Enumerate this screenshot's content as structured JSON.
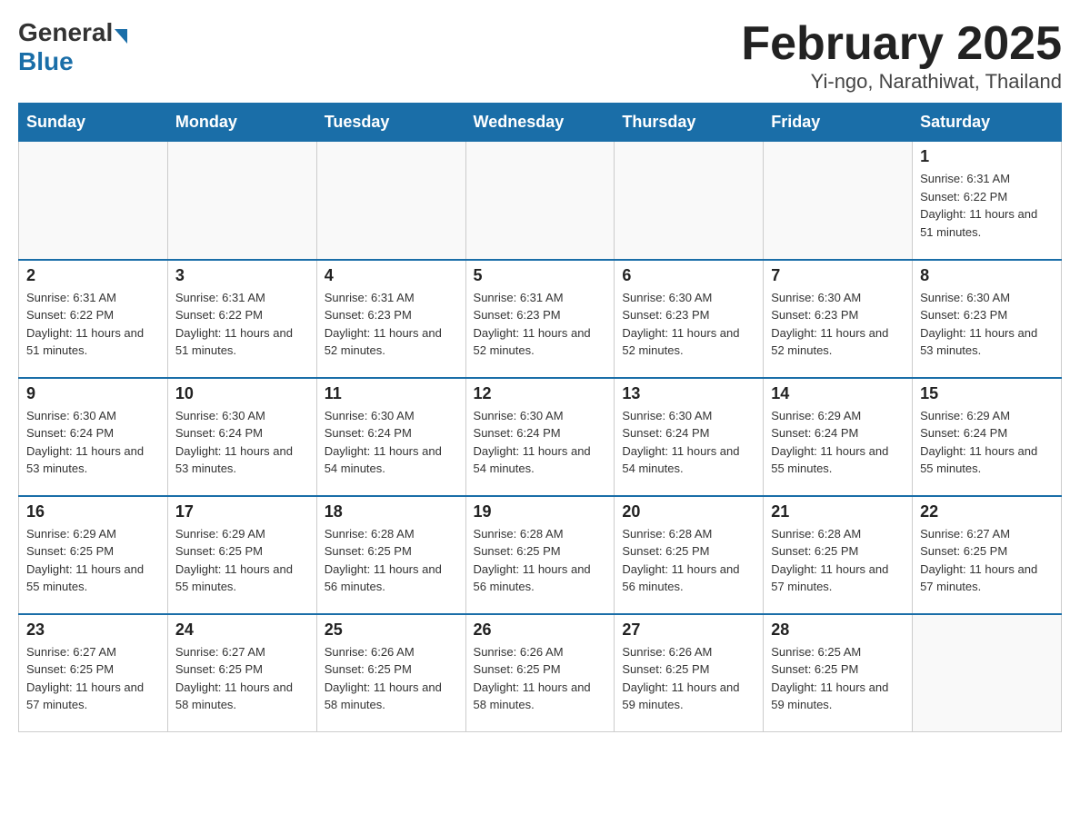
{
  "header": {
    "logo_general": "General",
    "logo_blue": "Blue",
    "month_title": "February 2025",
    "location": "Yi-ngo, Narathiwat, Thailand"
  },
  "days_of_week": [
    "Sunday",
    "Monday",
    "Tuesday",
    "Wednesday",
    "Thursday",
    "Friday",
    "Saturday"
  ],
  "weeks": [
    [
      {
        "day": "",
        "sunrise": "",
        "sunset": "",
        "daylight": ""
      },
      {
        "day": "",
        "sunrise": "",
        "sunset": "",
        "daylight": ""
      },
      {
        "day": "",
        "sunrise": "",
        "sunset": "",
        "daylight": ""
      },
      {
        "day": "",
        "sunrise": "",
        "sunset": "",
        "daylight": ""
      },
      {
        "day": "",
        "sunrise": "",
        "sunset": "",
        "daylight": ""
      },
      {
        "day": "",
        "sunrise": "",
        "sunset": "",
        "daylight": ""
      },
      {
        "day": "1",
        "sunrise": "Sunrise: 6:31 AM",
        "sunset": "Sunset: 6:22 PM",
        "daylight": "Daylight: 11 hours and 51 minutes."
      }
    ],
    [
      {
        "day": "2",
        "sunrise": "Sunrise: 6:31 AM",
        "sunset": "Sunset: 6:22 PM",
        "daylight": "Daylight: 11 hours and 51 minutes."
      },
      {
        "day": "3",
        "sunrise": "Sunrise: 6:31 AM",
        "sunset": "Sunset: 6:22 PM",
        "daylight": "Daylight: 11 hours and 51 minutes."
      },
      {
        "day": "4",
        "sunrise": "Sunrise: 6:31 AM",
        "sunset": "Sunset: 6:23 PM",
        "daylight": "Daylight: 11 hours and 52 minutes."
      },
      {
        "day": "5",
        "sunrise": "Sunrise: 6:31 AM",
        "sunset": "Sunset: 6:23 PM",
        "daylight": "Daylight: 11 hours and 52 minutes."
      },
      {
        "day": "6",
        "sunrise": "Sunrise: 6:30 AM",
        "sunset": "Sunset: 6:23 PM",
        "daylight": "Daylight: 11 hours and 52 minutes."
      },
      {
        "day": "7",
        "sunrise": "Sunrise: 6:30 AM",
        "sunset": "Sunset: 6:23 PM",
        "daylight": "Daylight: 11 hours and 52 minutes."
      },
      {
        "day": "8",
        "sunrise": "Sunrise: 6:30 AM",
        "sunset": "Sunset: 6:23 PM",
        "daylight": "Daylight: 11 hours and 53 minutes."
      }
    ],
    [
      {
        "day": "9",
        "sunrise": "Sunrise: 6:30 AM",
        "sunset": "Sunset: 6:24 PM",
        "daylight": "Daylight: 11 hours and 53 minutes."
      },
      {
        "day": "10",
        "sunrise": "Sunrise: 6:30 AM",
        "sunset": "Sunset: 6:24 PM",
        "daylight": "Daylight: 11 hours and 53 minutes."
      },
      {
        "day": "11",
        "sunrise": "Sunrise: 6:30 AM",
        "sunset": "Sunset: 6:24 PM",
        "daylight": "Daylight: 11 hours and 54 minutes."
      },
      {
        "day": "12",
        "sunrise": "Sunrise: 6:30 AM",
        "sunset": "Sunset: 6:24 PM",
        "daylight": "Daylight: 11 hours and 54 minutes."
      },
      {
        "day": "13",
        "sunrise": "Sunrise: 6:30 AM",
        "sunset": "Sunset: 6:24 PM",
        "daylight": "Daylight: 11 hours and 54 minutes."
      },
      {
        "day": "14",
        "sunrise": "Sunrise: 6:29 AM",
        "sunset": "Sunset: 6:24 PM",
        "daylight": "Daylight: 11 hours and 55 minutes."
      },
      {
        "day": "15",
        "sunrise": "Sunrise: 6:29 AM",
        "sunset": "Sunset: 6:24 PM",
        "daylight": "Daylight: 11 hours and 55 minutes."
      }
    ],
    [
      {
        "day": "16",
        "sunrise": "Sunrise: 6:29 AM",
        "sunset": "Sunset: 6:25 PM",
        "daylight": "Daylight: 11 hours and 55 minutes."
      },
      {
        "day": "17",
        "sunrise": "Sunrise: 6:29 AM",
        "sunset": "Sunset: 6:25 PM",
        "daylight": "Daylight: 11 hours and 55 minutes."
      },
      {
        "day": "18",
        "sunrise": "Sunrise: 6:28 AM",
        "sunset": "Sunset: 6:25 PM",
        "daylight": "Daylight: 11 hours and 56 minutes."
      },
      {
        "day": "19",
        "sunrise": "Sunrise: 6:28 AM",
        "sunset": "Sunset: 6:25 PM",
        "daylight": "Daylight: 11 hours and 56 minutes."
      },
      {
        "day": "20",
        "sunrise": "Sunrise: 6:28 AM",
        "sunset": "Sunset: 6:25 PM",
        "daylight": "Daylight: 11 hours and 56 minutes."
      },
      {
        "day": "21",
        "sunrise": "Sunrise: 6:28 AM",
        "sunset": "Sunset: 6:25 PM",
        "daylight": "Daylight: 11 hours and 57 minutes."
      },
      {
        "day": "22",
        "sunrise": "Sunrise: 6:27 AM",
        "sunset": "Sunset: 6:25 PM",
        "daylight": "Daylight: 11 hours and 57 minutes."
      }
    ],
    [
      {
        "day": "23",
        "sunrise": "Sunrise: 6:27 AM",
        "sunset": "Sunset: 6:25 PM",
        "daylight": "Daylight: 11 hours and 57 minutes."
      },
      {
        "day": "24",
        "sunrise": "Sunrise: 6:27 AM",
        "sunset": "Sunset: 6:25 PM",
        "daylight": "Daylight: 11 hours and 58 minutes."
      },
      {
        "day": "25",
        "sunrise": "Sunrise: 6:26 AM",
        "sunset": "Sunset: 6:25 PM",
        "daylight": "Daylight: 11 hours and 58 minutes."
      },
      {
        "day": "26",
        "sunrise": "Sunrise: 6:26 AM",
        "sunset": "Sunset: 6:25 PM",
        "daylight": "Daylight: 11 hours and 58 minutes."
      },
      {
        "day": "27",
        "sunrise": "Sunrise: 6:26 AM",
        "sunset": "Sunset: 6:25 PM",
        "daylight": "Daylight: 11 hours and 59 minutes."
      },
      {
        "day": "28",
        "sunrise": "Sunrise: 6:25 AM",
        "sunset": "Sunset: 6:25 PM",
        "daylight": "Daylight: 11 hours and 59 minutes."
      },
      {
        "day": "",
        "sunrise": "",
        "sunset": "",
        "daylight": ""
      }
    ]
  ]
}
